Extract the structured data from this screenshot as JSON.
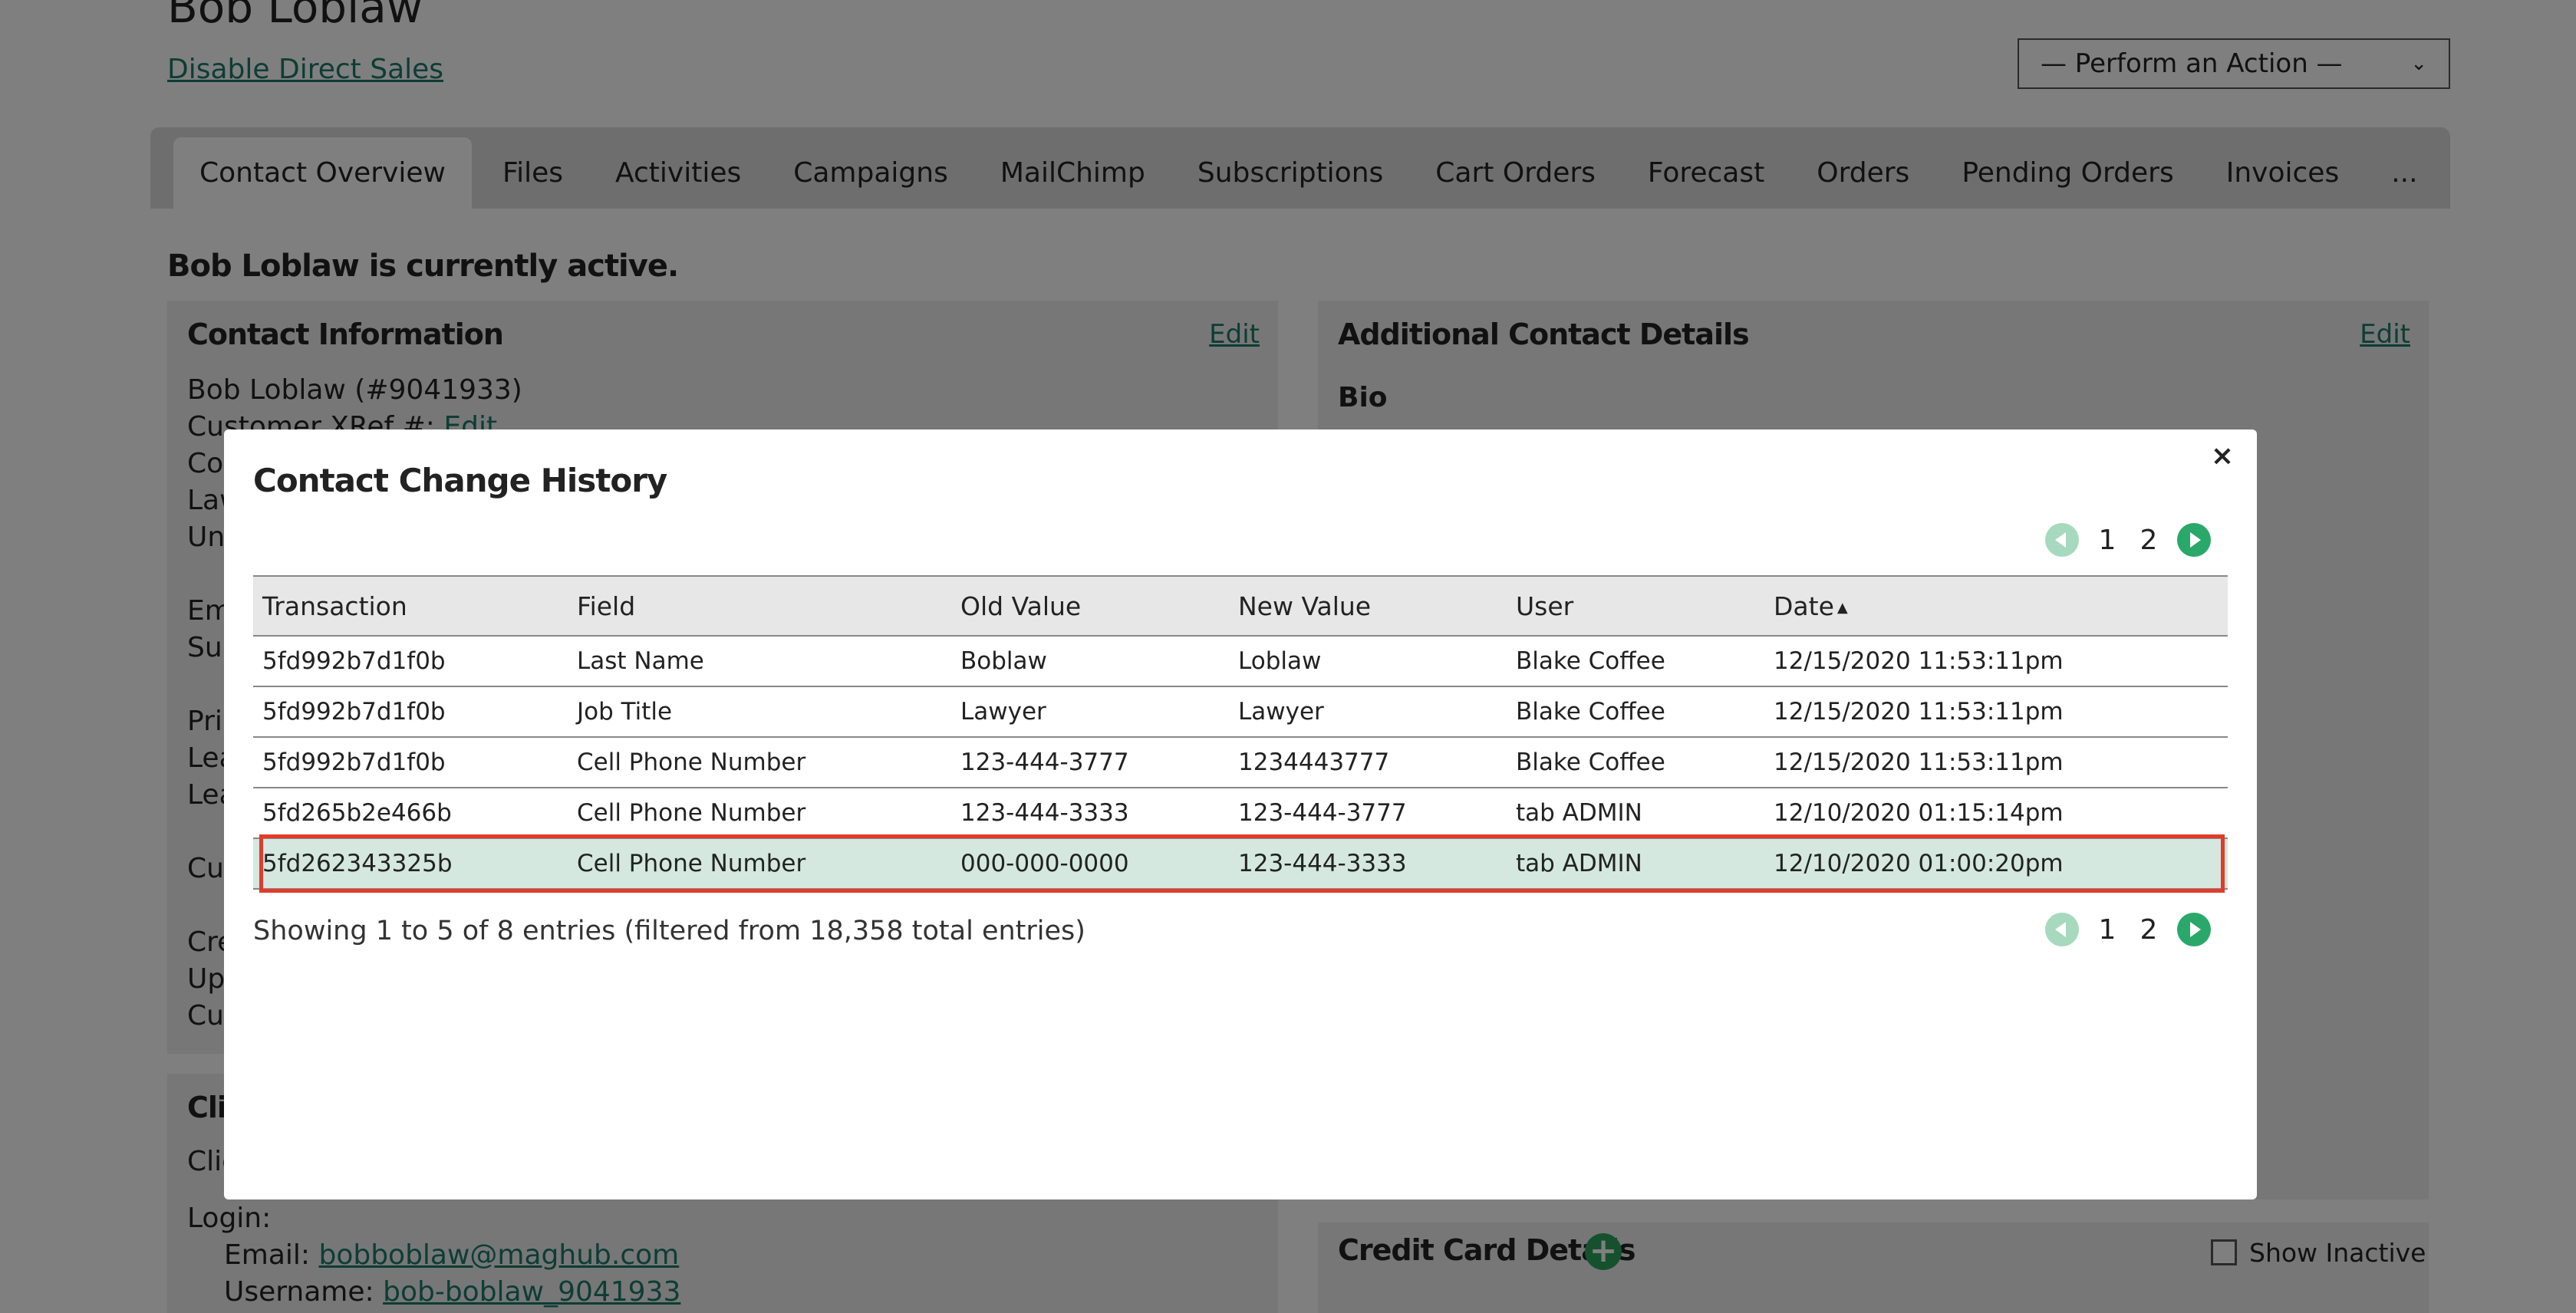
{
  "page": {
    "title": "Bob Loblaw",
    "disable_link": "Disable Direct Sales",
    "action_select": "— Perform an Action —",
    "status": "Bob Loblaw is currently active.",
    "tabs": [
      "Contact Overview",
      "Files",
      "Activities",
      "Campaigns",
      "MailChimp",
      "Subscriptions",
      "Cart Orders",
      "Forecast",
      "Orders",
      "Pending Orders",
      "Invoices",
      "..."
    ]
  },
  "contact_info": {
    "title": "Contact Information",
    "edit": "Edit",
    "name_line": "Bob Loblaw (#9041933)",
    "xref_label": "Customer XRef #:",
    "xref_edit": "Edit",
    "partial_lines": [
      "Co",
      "Law",
      "Un",
      "Em",
      "Sub",
      "Pri",
      "Lea",
      "Lea",
      "Cur",
      "Cre",
      "Up",
      "Cur"
    ]
  },
  "additional_details": {
    "title": "Additional Contact Details",
    "edit": "Edit",
    "bio_label": "Bio"
  },
  "client_panel": {
    "partial_title": "Clie",
    "partial_line": "Clie",
    "login_label": "Login:",
    "email_label": "Email:",
    "email_value": "bobboblaw@maghub.com",
    "username_label": "Username:",
    "username_value": "bob-boblaw_9041933"
  },
  "credit_card": {
    "title": "Credit Card Details",
    "show_inactive": "Show Inactive"
  },
  "modal": {
    "title": "Contact Change History",
    "close": "×",
    "pages": [
      "1",
      "2"
    ],
    "columns": [
      "Transaction",
      "Field",
      "Old Value",
      "New Value",
      "User",
      "Date"
    ],
    "rows": [
      [
        "5fd992b7d1f0b",
        "Last Name",
        "Boblaw",
        "Loblaw",
        "Blake Coffee",
        "12/15/2020 11:53:11pm"
      ],
      [
        "5fd992b7d1f0b",
        "Job Title",
        "Lawyer",
        "Lawyer",
        "Blake Coffee",
        "12/15/2020 11:53:11pm"
      ],
      [
        "5fd992b7d1f0b",
        "Cell Phone Number",
        "123-444-3777",
        "1234443777",
        "Blake Coffee",
        "12/15/2020 11:53:11pm"
      ],
      [
        "5fd265b2e466b",
        "Cell Phone Number",
        "123-444-3333",
        "123-444-3777",
        "tab ADMIN",
        "12/10/2020 01:15:14pm"
      ],
      [
        "5fd262343325b",
        "Cell Phone Number",
        "000-000-0000",
        "123-444-3333",
        "tab ADMIN",
        "12/10/2020 01:00:20pm"
      ]
    ],
    "showing": "Showing 1 to 5 of 8 entries (filtered from 18,358 total entries)"
  },
  "colors": {
    "link": "#1a7a6a",
    "pager_active": "#2aa86a",
    "pager_disabled": "#a6d9bd",
    "highlight_row": "#d4e8df",
    "highlight_border": "#e23b2a"
  }
}
